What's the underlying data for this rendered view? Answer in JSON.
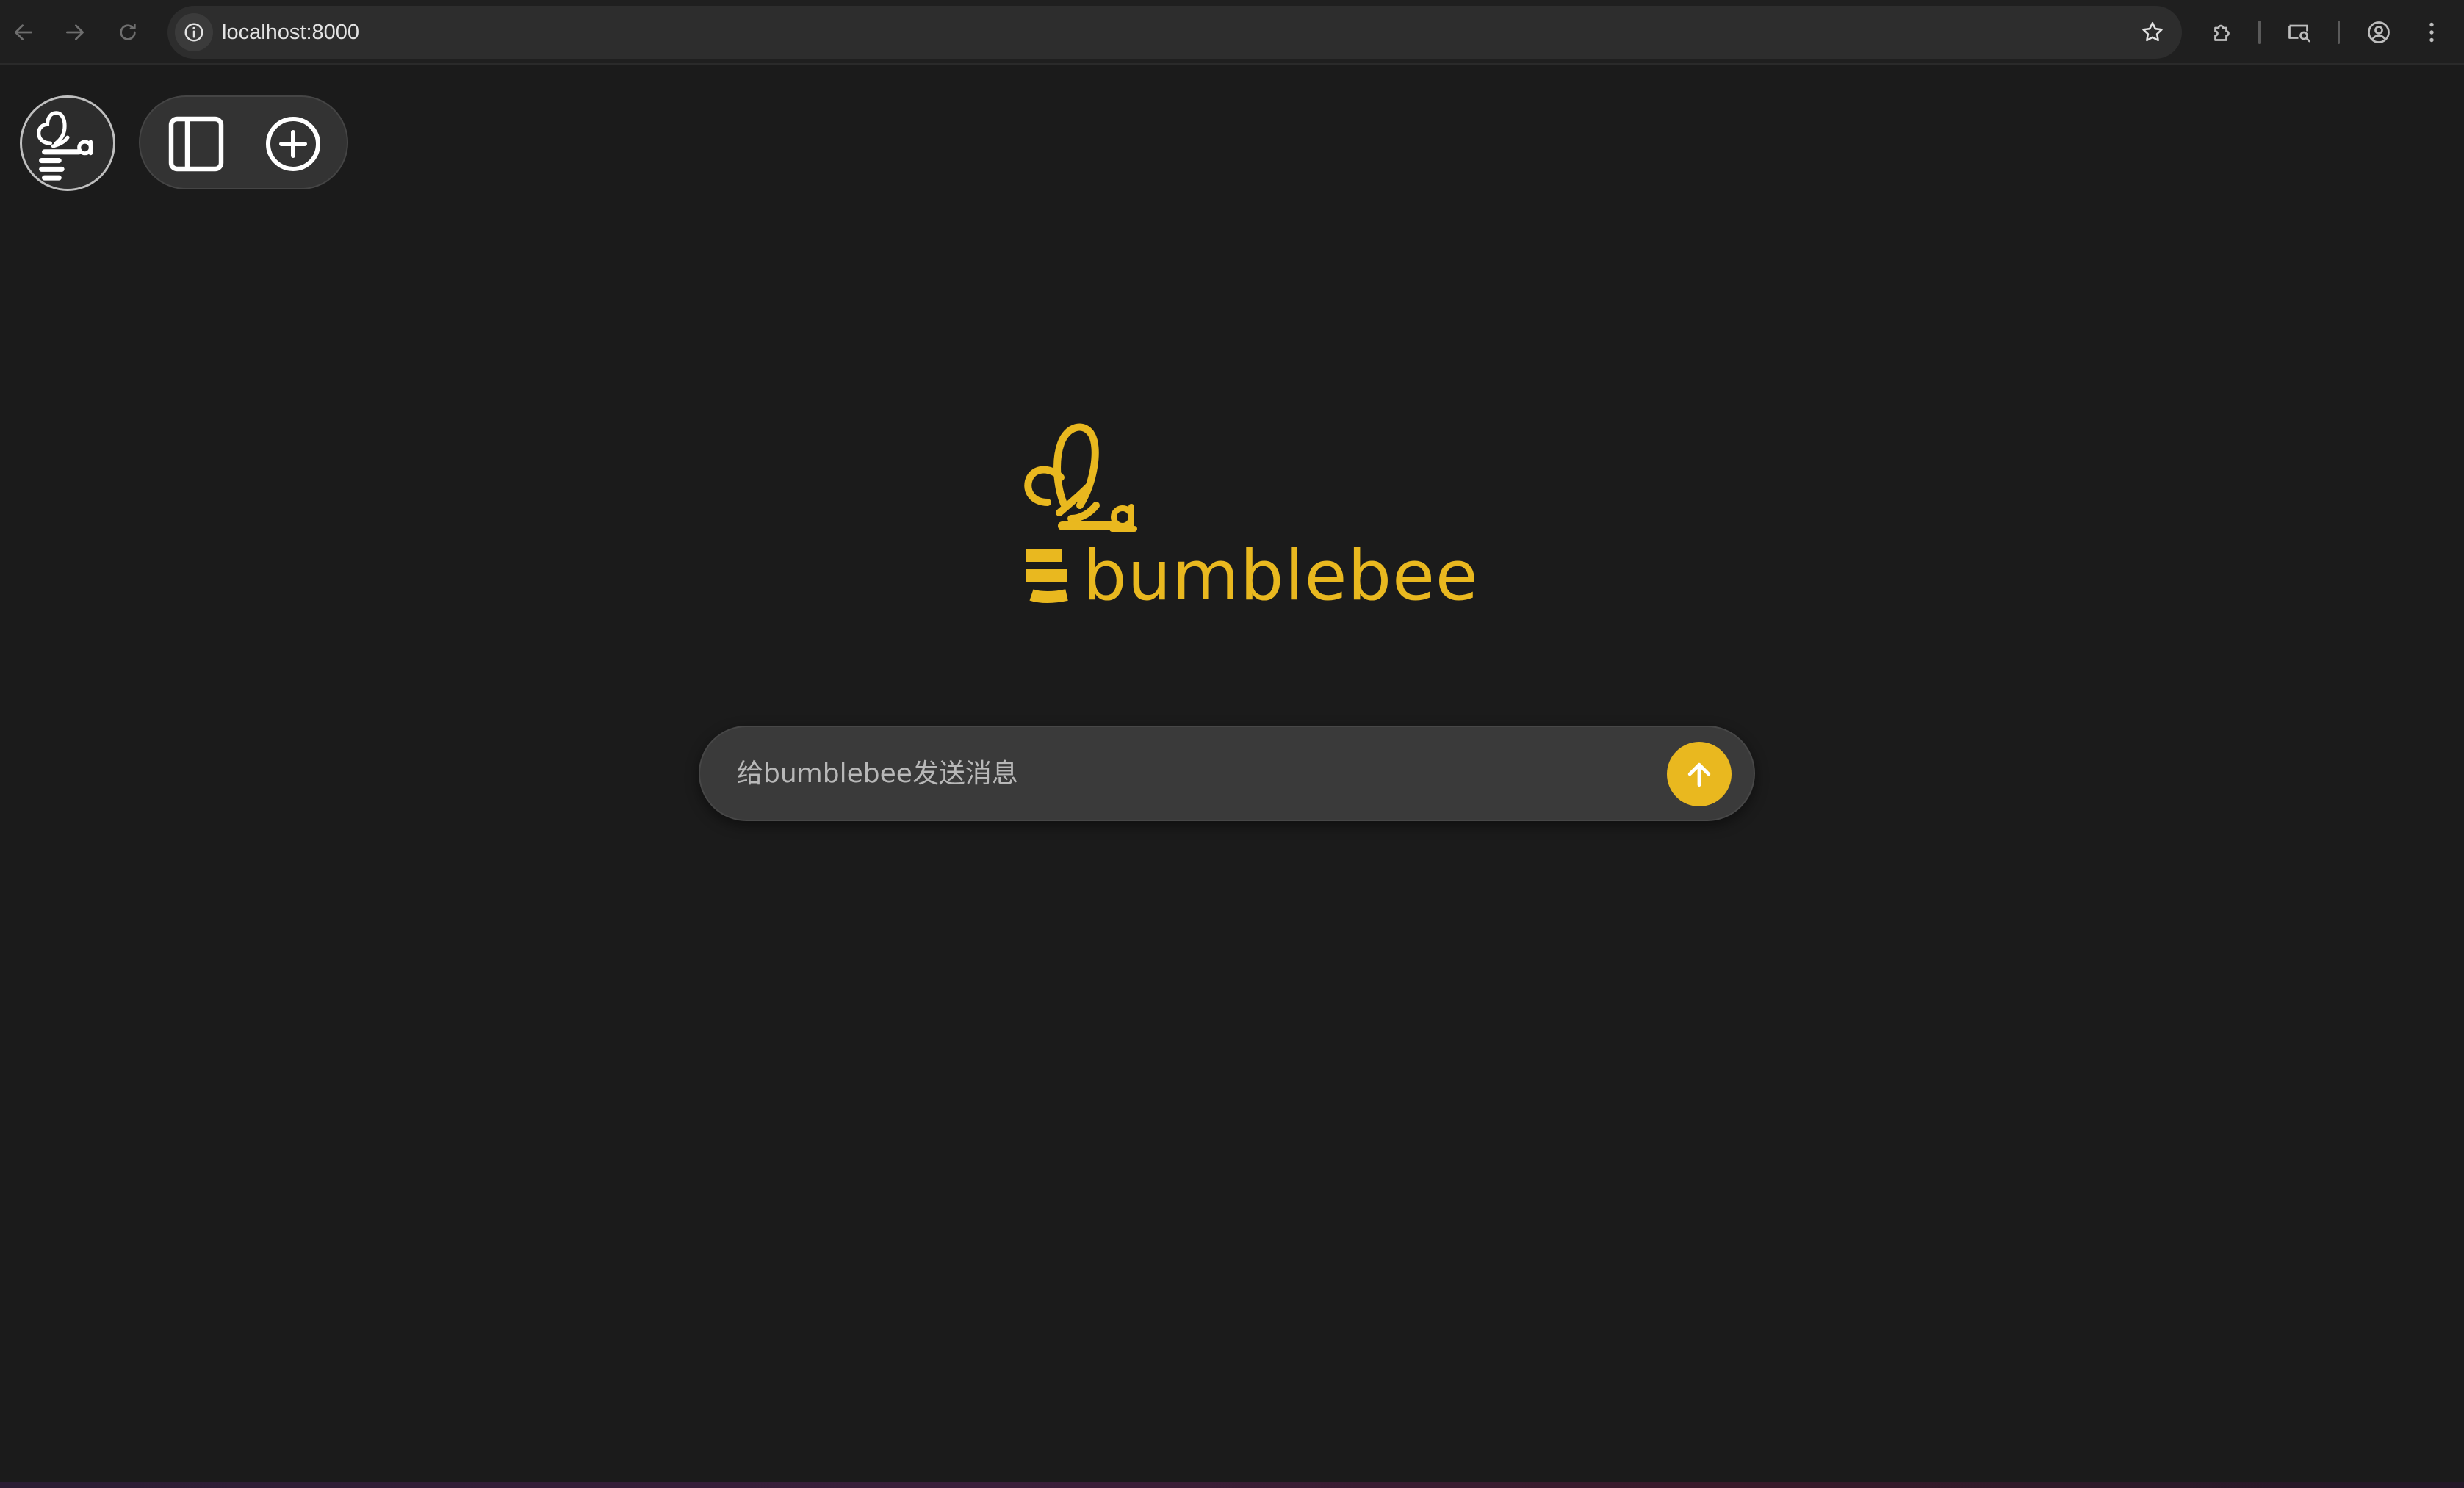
{
  "browser": {
    "url": "localhost:8000",
    "buttons": {
      "back": "arrow-left-icon",
      "forward": "arrow-right-icon",
      "reload": "reload-icon",
      "site_info": "info-icon",
      "bookmark": "star-icon",
      "extensions": "puzzle-icon",
      "cast": "cast-search-icon",
      "profile": "profile-icon",
      "menu": "kebab-menu-icon"
    }
  },
  "app": {
    "avatar_icon": "bee-logo-icon",
    "sidebar_toggle_icon": "sidebar-toggle-icon",
    "new_chat_icon": "plus-circle-icon",
    "brand": {
      "wordmark": "bumblebee",
      "color": "#e9b81f"
    },
    "composer": {
      "placeholder": "给bumblebee发送消息",
      "send_icon": "arrow-up-icon"
    }
  },
  "colors": {
    "background": "#1b1b1b",
    "accent": "#e9b81f",
    "composer_bg": "#3a3a3a"
  }
}
